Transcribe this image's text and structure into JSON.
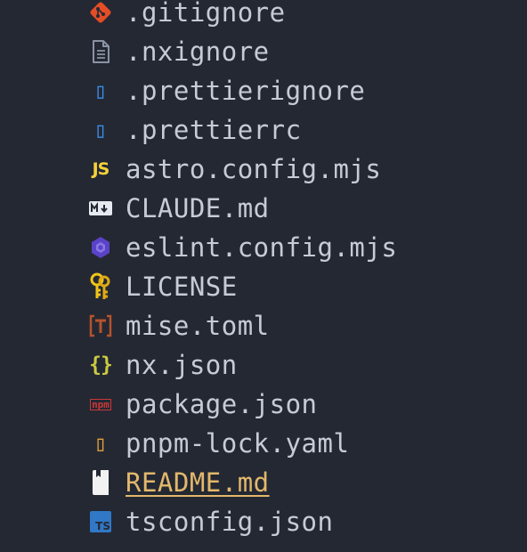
{
  "explorer": {
    "files": [
      {
        "name": ".gitignore",
        "icon": "git-icon",
        "color": "#e44d26"
      },
      {
        "name": ".nxignore",
        "icon": "file-text-icon",
        "color": "#8a93a3"
      },
      {
        "name": ".prettierignore",
        "icon": "missing-glyph-icon",
        "color": "#3b8eea",
        "glyph": "▯"
      },
      {
        "name": ".prettierrc",
        "icon": "missing-glyph-icon",
        "color": "#3b8eea",
        "glyph": "▯"
      },
      {
        "name": "astro.config.mjs",
        "icon": "javascript-icon",
        "color": "#f5d23a",
        "glyph": "JS"
      },
      {
        "name": "CLAUDE.md",
        "icon": "markdown-icon",
        "color": "#e6e9ef"
      },
      {
        "name": "eslint.config.mjs",
        "icon": "eslint-icon",
        "color": "#5b43c8"
      },
      {
        "name": "LICENSE",
        "icon": "license-key-icon",
        "color": "#f0c419"
      },
      {
        "name": "mise.toml",
        "icon": "toml-icon",
        "color": "#b5532c",
        "glyph": "T"
      },
      {
        "name": "nx.json",
        "icon": "json-braces-icon",
        "color": "#cbcb41",
        "glyph": "{}"
      },
      {
        "name": "package.json",
        "icon": "npm-icon",
        "color": "#cb3837",
        "glyph": "npm"
      },
      {
        "name": "pnpm-lock.yaml",
        "icon": "missing-glyph-icon",
        "color": "#e2a33a",
        "glyph": "▯"
      },
      {
        "name": "README.md",
        "icon": "book-icon",
        "color": "#f2f2f2",
        "modified": true
      },
      {
        "name": "tsconfig.json",
        "icon": "typescript-icon",
        "color": "#3178c6",
        "glyph": "TS"
      }
    ]
  }
}
